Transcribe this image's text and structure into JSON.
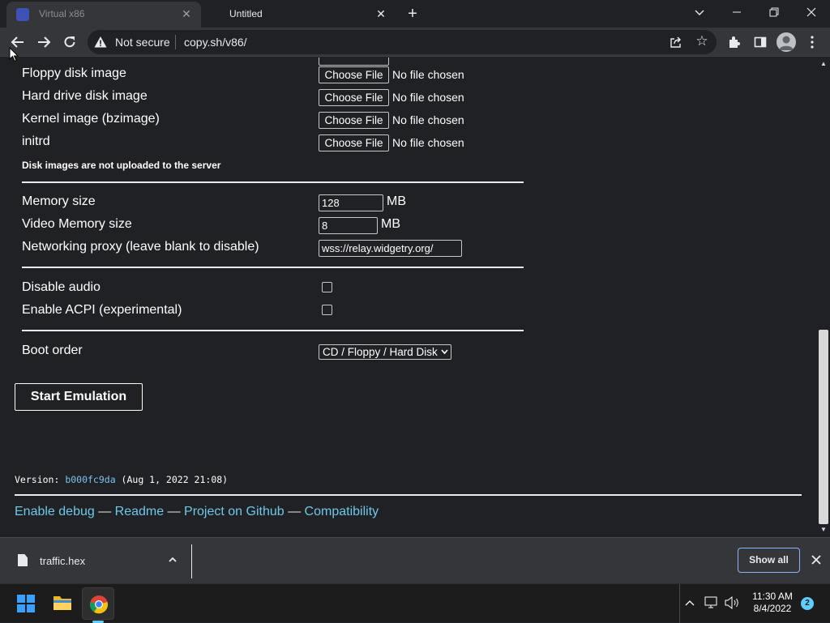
{
  "browser": {
    "tabs": [
      {
        "title": "Virtual x86",
        "active": false
      },
      {
        "title": "Untitled",
        "active": true
      }
    ],
    "new_tab_symbol": "+",
    "security_label": "Not secure",
    "url": "copy.sh/v86/",
    "icons": [
      "back-icon",
      "forward-icon",
      "reload-icon",
      "warning-icon",
      "share-icon",
      "star-icon",
      "extensions-icon",
      "sidebar-icon",
      "profile-icon",
      "menu-icon"
    ]
  },
  "form": {
    "floppy_label": "Floppy disk image",
    "hdd_label": "Hard drive disk image",
    "kernel_label": "Kernel image (bzimage)",
    "initrd_label": "initrd",
    "choose_file_label": "Choose File",
    "no_file_text": "No file chosen",
    "upload_note": "Disk images are not uploaded to the server",
    "memory_label": "Memory size",
    "memory_value": "128",
    "memory_unit": "MB",
    "vga_label": "Video Memory size",
    "vga_value": "8",
    "vga_unit": "MB",
    "proxy_label": "Networking proxy (leave blank to disable)",
    "proxy_value": "wss://relay.widgetry.org/",
    "disable_audio_label": "Disable audio",
    "disable_audio_checked": false,
    "acpi_label": "Enable ACPI (experimental)",
    "acpi_checked": false,
    "boot_order_label": "Boot order",
    "boot_order_value": "CD / Floppy / Hard Disk",
    "start_button_label": "Start Emulation"
  },
  "footer": {
    "version_prefix": "Version: ",
    "version_hash": "b000fc9da",
    "version_date": " (Aug 1, 2022 21:08)",
    "link_debug": "Enable debug",
    "link_readme": "Readme",
    "link_github": "Project on Github",
    "link_compat": "Compatibility",
    "separator": " — "
  },
  "downloads": {
    "file_name": "traffic.hex",
    "show_all_label": "Show all"
  },
  "taskbar": {
    "time": "11:30 AM",
    "date": "8/4/2022",
    "notification_count": "2"
  },
  "colors": {
    "page_bg": "#202124",
    "link": "#6ec8e8",
    "hash": "#7cc4f0",
    "accent": "#8ab4f8"
  }
}
